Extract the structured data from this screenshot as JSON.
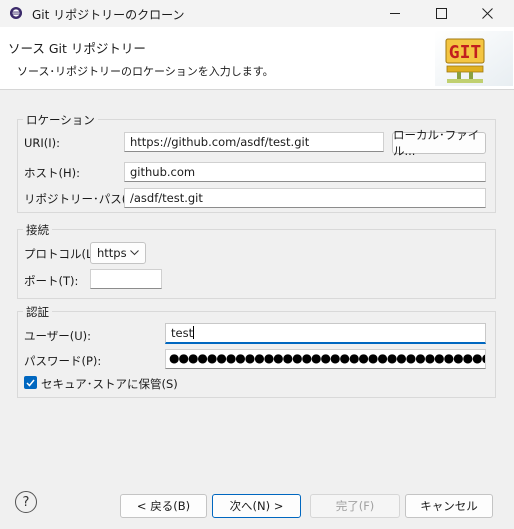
{
  "window": {
    "title": "Git リポジトリーのクローン"
  },
  "header": {
    "title": "ソース Git リポジトリー",
    "description": "ソース･リポジトリーのロケーションを入力します。",
    "logo_text": "GIT"
  },
  "location": {
    "group_label": "ロケーション",
    "uri_label": "URI(I):",
    "uri_value": "https://github.com/asdf/test.git",
    "local_file_button": "ローカル･ファイル...",
    "host_label": "ホスト(H):",
    "host_value": "github.com",
    "repo_path_label": "リポジトリー･パス(R):",
    "repo_path_value": "/asdf/test.git"
  },
  "connection": {
    "group_label": "接続",
    "protocol_label": "プロトコル(L):",
    "protocol_value": "https",
    "port_label": "ポート(T):",
    "port_value": ""
  },
  "auth": {
    "group_label": "認証",
    "user_label": "ユーザー(U):",
    "user_value": "test",
    "password_label": "パスワード(P):",
    "password_mask": "●●●●●●●●●●●●●●●●●●●●●●●●●●●●●●●●●●●●●",
    "store_label": "セキュア･ストアに保管(S)",
    "store_checked": true
  },
  "footer": {
    "back": "< 戻る(B)",
    "next": "次へ(N) >",
    "finish": "完了(F)",
    "cancel": "キャンセル"
  },
  "colors": {
    "accent": "#0067c0",
    "git_logo_bg": "#f4c542",
    "git_logo_text": "#c21f1f"
  }
}
